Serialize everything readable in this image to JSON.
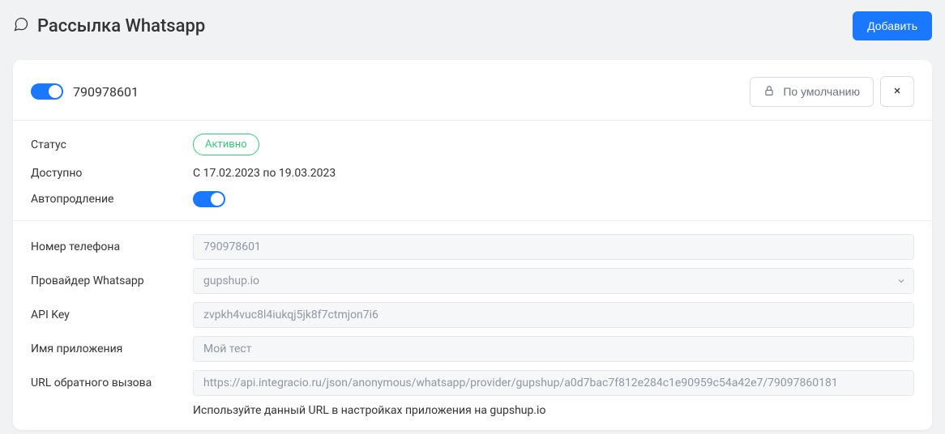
{
  "header": {
    "title": "Рассылка Whatsapp",
    "add_button": "Добавить"
  },
  "card": {
    "title": "790978601",
    "default_button": "По умолчанию",
    "status": {
      "label": "Статус",
      "value": "Активно"
    },
    "availability": {
      "label": "Доступно",
      "value": "С 17.02.2023 по 19.03.2023"
    },
    "autorenew": {
      "label": "Автопродление"
    },
    "form": {
      "phone": {
        "label": "Номер телефона",
        "value": "790978601"
      },
      "provider": {
        "label": "Провайдер Whatsapp",
        "value": "gupshup.io"
      },
      "api_key": {
        "label": "API Key",
        "value": "zvpkh4vuc8l4iukqj5jk8f7ctmjon7i6"
      },
      "app_name": {
        "label": "Имя приложения",
        "value": "Мой тест"
      },
      "callback_url": {
        "label": "URL обратного вызова",
        "value": "https://api.integracio.ru/json/anonymous/whatsapp/provider/gupshup/a0d7bac7f812e284c1e90959c54a42e7/79097860181",
        "help": "Используйте данный URL в настройках приложения на gupshup.io"
      }
    }
  }
}
